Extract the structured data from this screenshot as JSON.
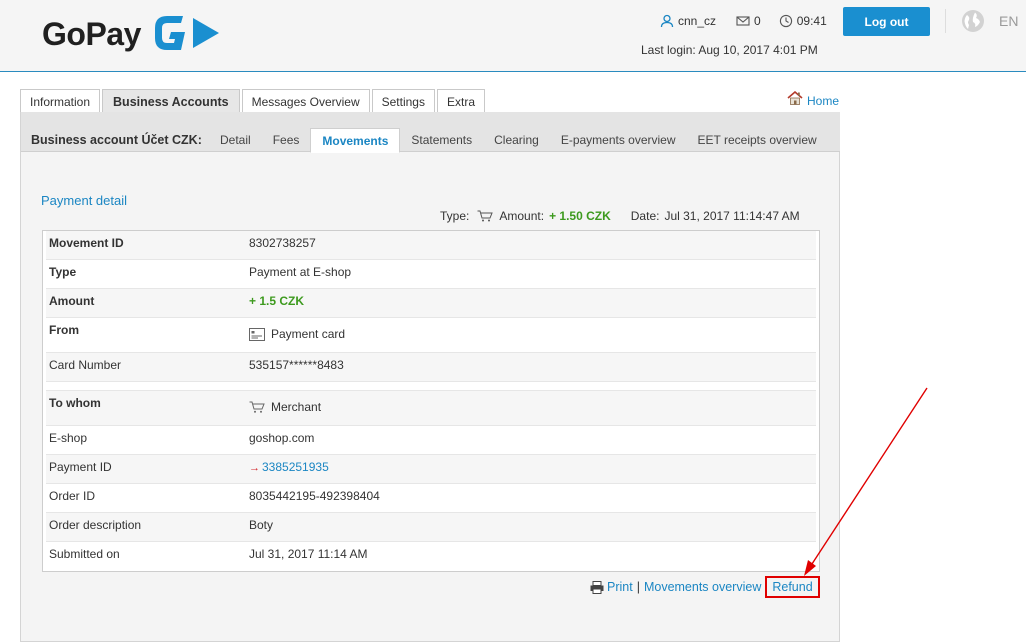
{
  "header": {
    "brand": "GoPay",
    "username": "cnn_cz",
    "messages_count": "0",
    "time": "09:41",
    "last_login": "Last login: Aug 10, 2017 4:01 PM",
    "logout_label": "Log out",
    "language": "EN"
  },
  "main_tabs": [
    {
      "label": "Information",
      "active": false
    },
    {
      "label": "Business Accounts",
      "active": true
    },
    {
      "label": "Messages Overview",
      "active": false
    },
    {
      "label": "Settings",
      "active": false
    },
    {
      "label": "Extra",
      "active": false
    }
  ],
  "home_label": "Home",
  "subnav": {
    "title": "Business account Účet CZK:",
    "tabs": [
      {
        "label": "Detail",
        "active": false
      },
      {
        "label": "Fees",
        "active": false
      },
      {
        "label": "Movements",
        "active": true
      },
      {
        "label": "Statements",
        "active": false
      },
      {
        "label": "Clearing",
        "active": false
      },
      {
        "label": "E-payments overview",
        "active": false
      },
      {
        "label": "EET receipts overview",
        "active": false
      }
    ]
  },
  "section_title": "Payment detail",
  "summary": {
    "type_label": "Type:",
    "amount_label": "Amount:",
    "amount_value": "+ 1.50 CZK",
    "date_label": "Date:",
    "date_value": "Jul 31, 2017 11:14:47 AM"
  },
  "details": {
    "movement_id": {
      "label": "Movement ID",
      "value": "8302738257"
    },
    "type": {
      "label": "Type",
      "value": "Payment at E-shop"
    },
    "amount": {
      "label": "Amount",
      "value": "+ 1.5 CZK"
    },
    "from": {
      "label": "From",
      "value": "Payment card"
    },
    "card_number": {
      "label": "Card Number",
      "value": "535157******8483"
    },
    "to_whom": {
      "label": "To whom",
      "value": "Merchant"
    },
    "eshop": {
      "label": "E-shop",
      "value": "goshop.com"
    },
    "payment_id": {
      "label": "Payment ID",
      "value": "3385251935"
    },
    "order_id": {
      "label": "Order ID",
      "value": "8035442195-492398404"
    },
    "order_description": {
      "label": "Order description",
      "value": "Boty"
    },
    "submitted_on": {
      "label": "Submitted on",
      "value": "Jul 31, 2017 11:14 AM"
    }
  },
  "footer": {
    "print_label": "Print",
    "separator": "|",
    "movements_overview_label": "Movements overview",
    "refund_label": "Refund"
  },
  "colors": {
    "accent": "#1b86c3",
    "button": "#1a8fd0",
    "positive_amount": "#3d9a1e",
    "highlight": "#e00000"
  }
}
